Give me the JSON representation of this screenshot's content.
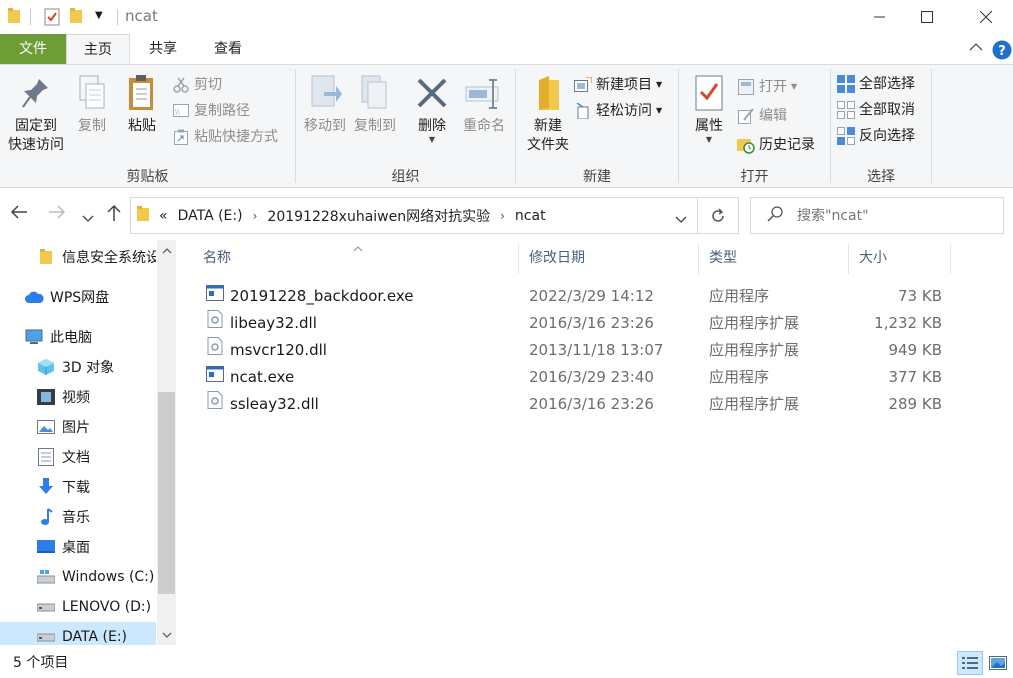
{
  "window": {
    "title": "ncat",
    "controls": [
      "minimize-icon",
      "maximize-icon",
      "close-icon"
    ]
  },
  "ribbon_tabs": {
    "file": "文件",
    "home": "主页",
    "share": "共享",
    "view": "查看"
  },
  "ribbon": {
    "clipboard": {
      "label": "剪贴板",
      "pin": "固定到\n快速访问",
      "copy": "复制",
      "paste": "粘贴",
      "cut": "剪切",
      "copy_path": "复制路径",
      "paste_shortcut": "粘贴快捷方式"
    },
    "organize": {
      "label": "组织",
      "move_to": "移动到",
      "copy_to": "复制到",
      "delete": "删除",
      "rename": "重命名"
    },
    "new": {
      "label": "新建",
      "new_folder": "新建\n文件夹",
      "new_item": "新建项目",
      "easy_access": "轻松访问"
    },
    "open": {
      "label": "打开",
      "properties": "属性",
      "open": "打开",
      "edit": "编辑",
      "history": "历史记录"
    },
    "select": {
      "label": "选择",
      "select_all": "全部选择",
      "select_none": "全部取消",
      "invert": "反向选择"
    }
  },
  "address": {
    "prefix": "«",
    "crumbs": [
      "DATA (E:)",
      "20191228xuhaiwen网络对抗实验",
      "ncat"
    ],
    "search_placeholder": "搜索\"ncat\""
  },
  "navpane": {
    "items": [
      {
        "label": "信息安全系统设",
        "icon": "folder-icon"
      },
      {
        "label": "WPS网盘",
        "icon": "cloud-icon"
      },
      {
        "label": "此电脑",
        "icon": "computer-icon"
      },
      {
        "label": "3D 对象",
        "icon": "3d-objects-icon"
      },
      {
        "label": "视频",
        "icon": "video-icon"
      },
      {
        "label": "图片",
        "icon": "pictures-icon"
      },
      {
        "label": "文档",
        "icon": "documents-icon"
      },
      {
        "label": "下载",
        "icon": "download-icon"
      },
      {
        "label": "音乐",
        "icon": "music-icon"
      },
      {
        "label": "桌面",
        "icon": "desktop-icon"
      },
      {
        "label": "Windows (C:)",
        "icon": "drive-icon"
      },
      {
        "label": "LENOVO (D:)",
        "icon": "drive-icon"
      },
      {
        "label": "DATA (E:)",
        "icon": "drive-icon"
      }
    ]
  },
  "filelist": {
    "columns": {
      "name": "名称",
      "date": "修改日期",
      "type": "类型",
      "size": "大小"
    },
    "rows": [
      {
        "name": "20191228_backdoor.exe",
        "date": "2022/3/29 14:12",
        "type": "应用程序",
        "size": "73 KB",
        "icon": "exe-icon"
      },
      {
        "name": "libeay32.dll",
        "date": "2016/3/16 23:26",
        "type": "应用程序扩展",
        "size": "1,232 KB",
        "icon": "dll-icon"
      },
      {
        "name": "msvcr120.dll",
        "date": "2013/11/18 13:07",
        "type": "应用程序扩展",
        "size": "949 KB",
        "icon": "dll-icon"
      },
      {
        "name": "ncat.exe",
        "date": "2016/3/29 23:40",
        "type": "应用程序",
        "size": "377 KB",
        "icon": "exe-icon"
      },
      {
        "name": "ssleay32.dll",
        "date": "2016/3/16 23:26",
        "type": "应用程序扩展",
        "size": "289 KB",
        "icon": "dll-icon"
      }
    ]
  },
  "status": {
    "item_count": "5 个项目"
  },
  "colors": {
    "file_tab": "#6e9c36",
    "selection": "#cce8ff",
    "column_header": "#4c607a",
    "folder": "#f2c94c"
  }
}
